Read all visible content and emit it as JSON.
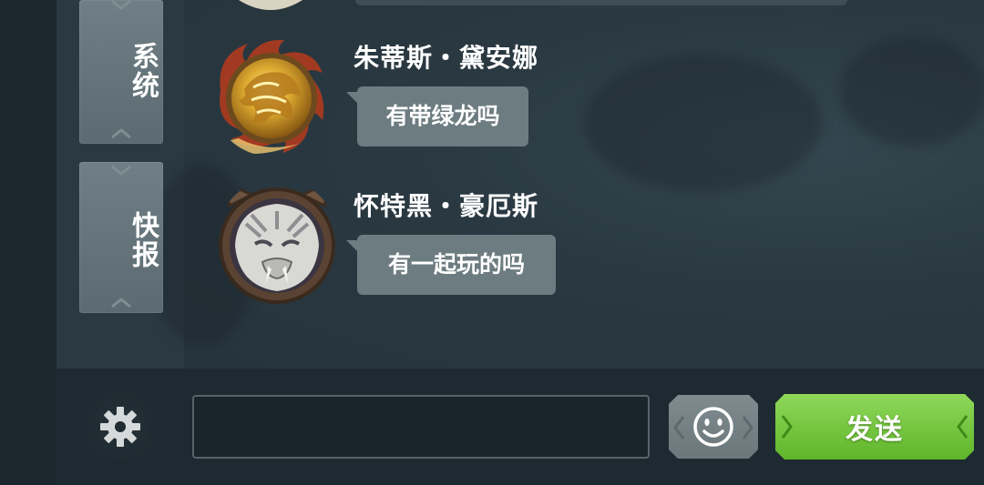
{
  "sidebar": {
    "tabs": [
      {
        "label": "系统"
      },
      {
        "label": "快报"
      }
    ]
  },
  "messages": [
    {
      "sender": "朱蒂斯・黛安娜",
      "text": "有带绿龙吗",
      "avatar": "golden-lion-crest-avatar"
    },
    {
      "sender": "怀特黑・豪厄斯",
      "text": "有一起玩的吗",
      "avatar": "white-lion-avatar"
    }
  ],
  "input": {
    "value": "",
    "placeholder": ""
  },
  "buttons": {
    "send_label": "发送",
    "settings_icon": "gear-icon",
    "emoji_icon": "smiley-icon"
  },
  "colors": {
    "send_button": "#6cc235",
    "bubble": "#6d7c80",
    "tab": "#67777d"
  }
}
